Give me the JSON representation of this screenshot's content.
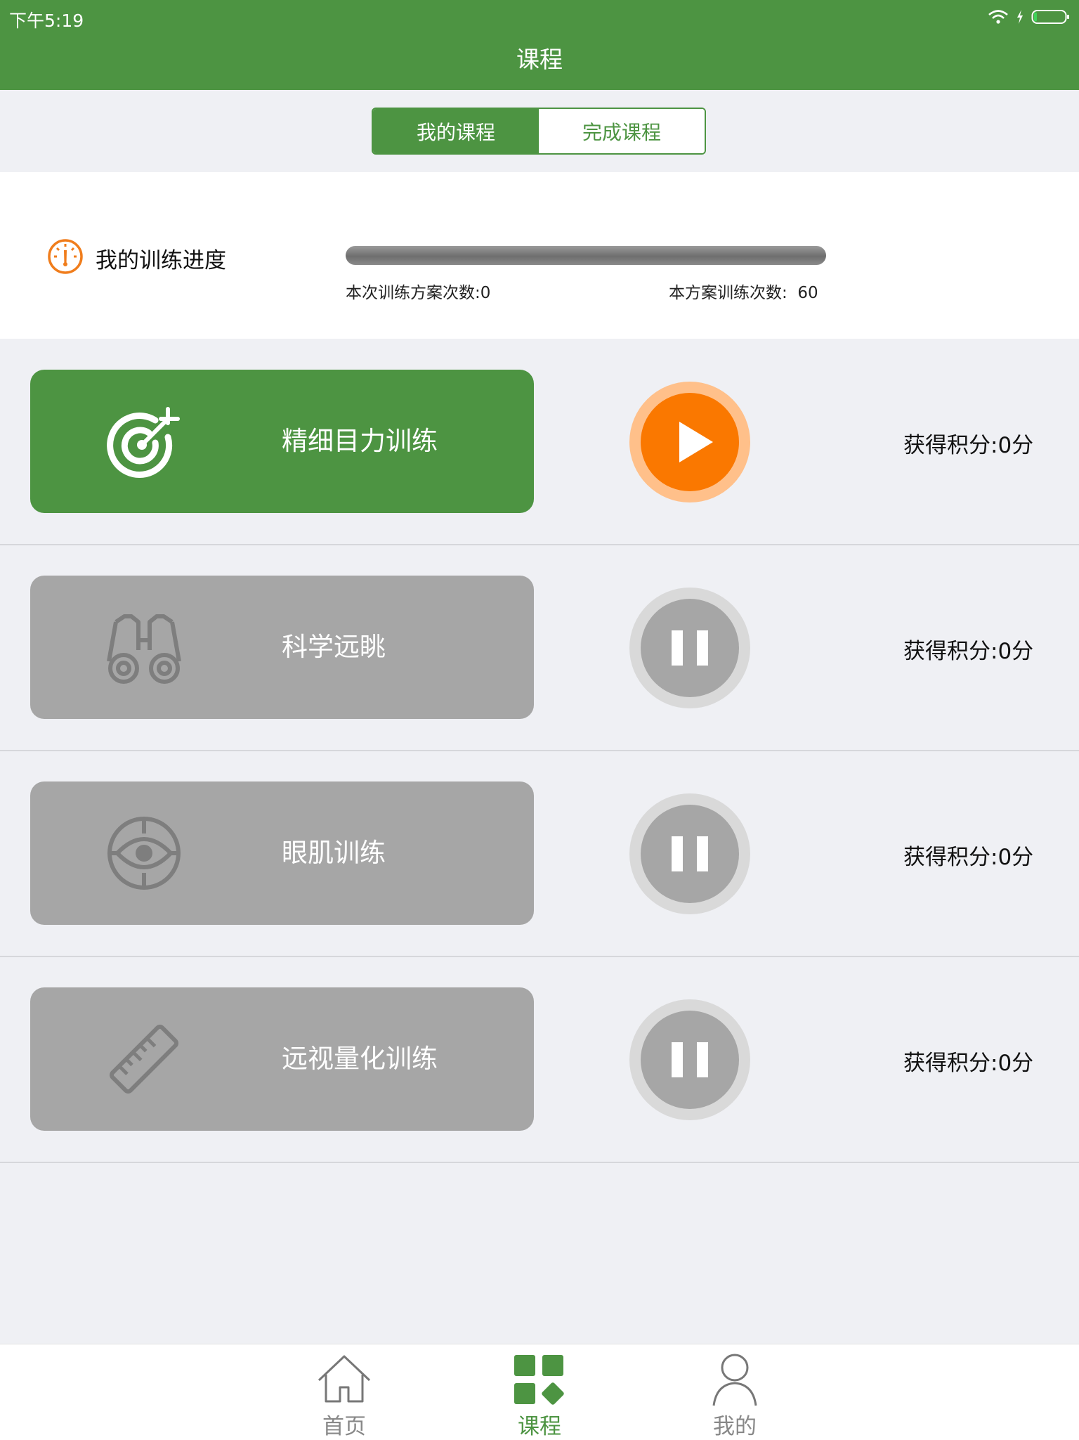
{
  "status_bar": {
    "time": "下午5:19"
  },
  "header": {
    "title": "课程"
  },
  "segment": {
    "tab_my": "我的课程",
    "tab_done": "完成课程"
  },
  "progress": {
    "title": "我的训练进度",
    "current_label": "本次训练方案次数:0",
    "total_label": "本方案训练次数:",
    "total_value": "60",
    "fill_fraction": 0
  },
  "courses": [
    {
      "name": "精细目力训练",
      "icon": "target-icon",
      "state": "play",
      "score": "获得积分:0分"
    },
    {
      "name": "科学远眺",
      "icon": "binoculars-icon",
      "state": "pause",
      "score": "获得积分:0分"
    },
    {
      "name": "眼肌训练",
      "icon": "eye-icon",
      "state": "pause",
      "score": "获得积分:0分"
    },
    {
      "name": "远视量化训练",
      "icon": "ruler-icon",
      "state": "pause",
      "score": "获得积分:0分"
    }
  ],
  "tabbar": {
    "home": "首页",
    "courses": "课程",
    "mine": "我的"
  },
  "colors": {
    "brand_green": "#4d9442",
    "accent_orange": "#fa7800",
    "inactive_gray": "#a6a6a6"
  }
}
